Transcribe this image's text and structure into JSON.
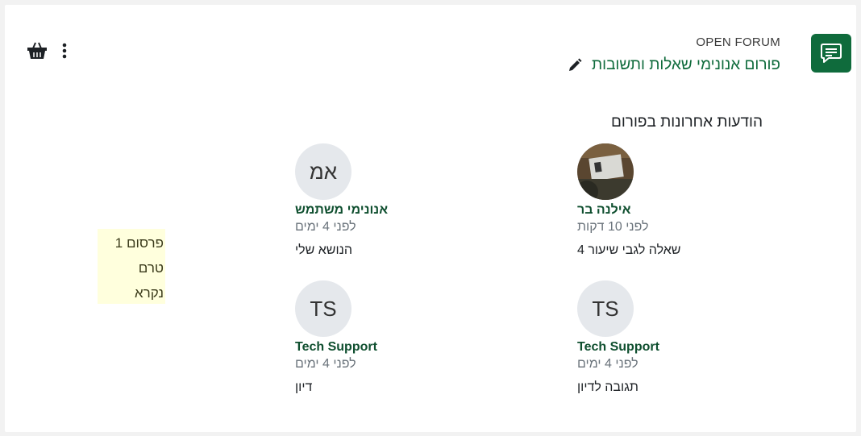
{
  "header": {
    "module_name": "OPEN FORUM",
    "title": "פורום אנונימי שאלות ותשובות",
    "accent_color": "#0f6b3c",
    "activity_icon": "forum-chat-icon",
    "edit_icon": "pencil-icon",
    "basket_icon": "basket-icon",
    "menu_icon": "kebab-menu-icon"
  },
  "recent": {
    "heading": "הודעות אחרונות בפורום",
    "posts": [
      {
        "author": "אילנה בר",
        "avatar": "",
        "time": "לפני 10 דקות",
        "subject": "שאלה לגבי שיעור 4"
      },
      {
        "author": "אנונימי משתמש",
        "avatar": "אמ",
        "time": "לפני 4 ימים",
        "subject": "הנושא שלי"
      },
      {
        "author": "Tech Support",
        "avatar": "TS",
        "time": "לפני 4 ימים",
        "subject": "תגובה לדיון"
      },
      {
        "author": "Tech Support",
        "avatar": "TS",
        "time": "לפני 4 ימים",
        "subject": "דיון"
      }
    ]
  },
  "unread": {
    "line1": "פרסום 1",
    "line2": "טרם",
    "line3": "נקרא"
  }
}
